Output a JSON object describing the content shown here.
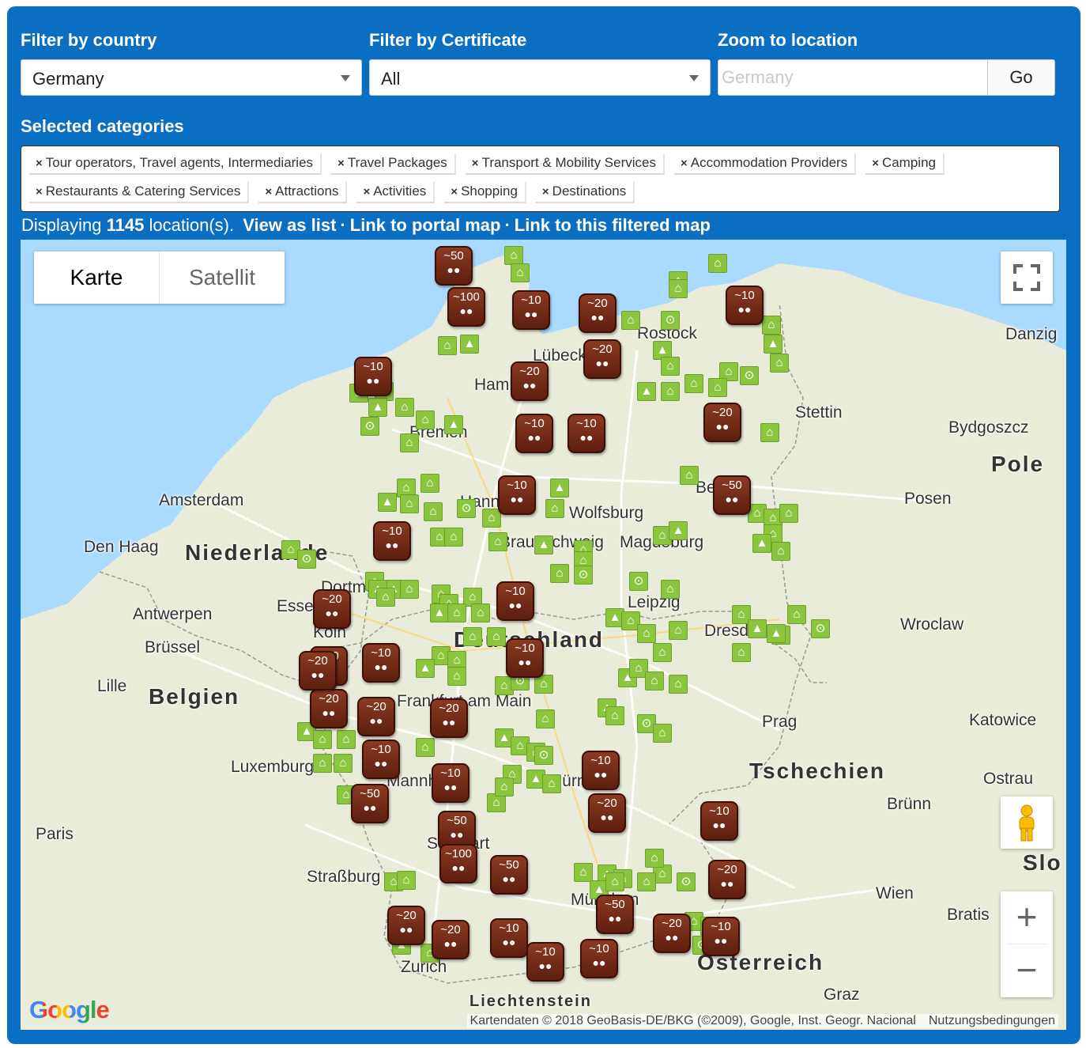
{
  "filters": {
    "country_label": "Filter by country",
    "country_value": "Germany",
    "certificate_label": "Filter by Certificate",
    "certificate_value": "All",
    "zoom_label": "Zoom to location",
    "zoom_placeholder": "Germany",
    "go_label": "Go"
  },
  "categories": {
    "label": "Selected categories",
    "remove_glyph": "×",
    "items": [
      "Tour operators, Travel agents, Intermediaries",
      "Travel Packages",
      "Transport & Mobility Services",
      "Accommodation Providers",
      "Camping",
      "Restaurants & Catering Services",
      "Attractions",
      "Activities",
      "Shopping",
      "Destinations"
    ]
  },
  "summary": {
    "prefix": "Displaying",
    "count": "1145",
    "suffix": "location(s).",
    "view_list": "View as list",
    "portal_map": "Link to portal map",
    "filtered_map": "Link to this filtered map",
    "separator": "·"
  },
  "map": {
    "map_type": {
      "map": "Karte",
      "satellite": "Satellit"
    },
    "icons": {
      "fullscreen": "fullscreen-icon",
      "pegman": "pegman-icon",
      "zoom_in": "+",
      "zoom_out": "−"
    },
    "logo": "Google",
    "attribution": "Kartendaten © 2018 GeoBasis-DE/BKG (©2009), Google, Inst. Geogr. Nacional",
    "terms": "Nutzungsbedingungen",
    "countries": [
      "Niederlande",
      "Belgien",
      "Deutschland",
      "Tschechien",
      "Österreich",
      "Pole",
      "Slo",
      "Liechtenstein"
    ],
    "cities": [
      "Amsterdam",
      "Den Haag",
      "Antwerpen",
      "Brüssel",
      "Lille",
      "Luxemburg",
      "Paris",
      "Straßburg",
      "Zurich",
      "Lübeck",
      "Hamburg",
      "Bremen",
      "Rostock",
      "Stettin",
      "Danzig",
      "Bydgoszcz",
      "Posen",
      "Wolfsburg",
      "Braunschweig",
      "Magdeburg",
      "Berlin",
      "Leipzig",
      "Dresden",
      "Wroclaw",
      "Prag",
      "Katowice",
      "Ostrau",
      "Brünn",
      "Wien",
      "Bratis",
      "Graz",
      "München",
      "Nürnberg",
      "Mannheim",
      "Frankfurt am Main",
      "Stuttgart",
      "Köln",
      "Essen",
      "Dortmund",
      "Hannover"
    ],
    "clusters": [
      "~50",
      "~100",
      "~10",
      "~20",
      "~10",
      "~10",
      "~20",
      "~20",
      "~10",
      "~10",
      "~10",
      "~20",
      "~10",
      "~50",
      "~10",
      "~20",
      "~10",
      "~20",
      "~10",
      "~20",
      "~10",
      "~20",
      "~10",
      "~20",
      "~10",
      "~50",
      "~10",
      "~20",
      "~50",
      "~100",
      "~50",
      "~10",
      "~20",
      "~50",
      "~20",
      "~20",
      "~10",
      "~10",
      "~10",
      "~20",
      "~20"
    ],
    "colors": {
      "marker": "#8cc63f",
      "cluster": "#6b2412",
      "water": "#aadaff",
      "land": "#e9ecd9",
      "panel": "#0a6fc2"
    }
  }
}
